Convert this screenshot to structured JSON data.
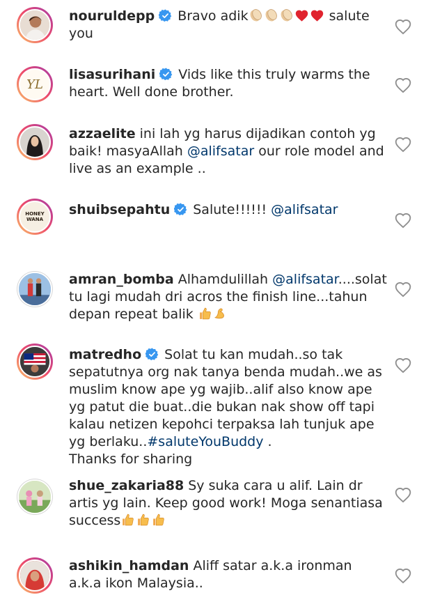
{
  "comments": [
    {
      "username": "nouruldepp",
      "verified": true,
      "text_1": "Bravo adik",
      "text_2": " salute you",
      "avatar_icon": "portrait-woman-icon"
    },
    {
      "username": "lisasurihani",
      "verified": true,
      "text": "Vids like this truly warms the heart. Well done brother.",
      "avatar_icon": "monogram-logo-icon",
      "avatar_text": "YL"
    },
    {
      "username": "azzaelite",
      "verified": false,
      "text_1": "ini lah yg harus dijadikan contoh yg baik! masyaAllah ",
      "mention": "@alifsatar",
      "text_2": " our role model and live as an example .."
    },
    {
      "username": "shuibsepahtu",
      "verified": true,
      "text_1": "Salute!!!!!! ",
      "mention": "@alifsatar",
      "avatar_text": "HONEY WANA"
    },
    {
      "username": "amran_bomba",
      "verified": false,
      "text_1": "Alhamdulillah ",
      "mention": "@alifsatar",
      "text_2": "....solat tu lagi mudah dri acros the finish line...tahun depan repeat balik "
    },
    {
      "username": "matredho",
      "verified": true,
      "text_1": "Solat tu kan mudah..so tak sepatutnya org nak tanya benda mudah..we as muslim know ape yg wajib..alif also know ape yg patut die buat..die bukan nak show off tapi kalau netizen kepohci terpaksa lah tunjuk ape yg berlaku..",
      "hashtag": "#saluteYouBuddy",
      "text_2": " .",
      "text_3": "Thanks for sharing"
    },
    {
      "username": "shue_zakaria88",
      "verified": false,
      "text": "Sy suka cara u alif. Lain dr artis yg lain. Keep good work! Moga senantiasa success"
    },
    {
      "username": "ashikin_hamdan",
      "verified": false,
      "text": "Aliff satar a.k.a ironman a.k.a ikon Malaysia.."
    }
  ],
  "colors": {
    "mention": "#00376b",
    "verified": "#3897f0",
    "text": "#262626",
    "heart": "#8e8e8e"
  }
}
